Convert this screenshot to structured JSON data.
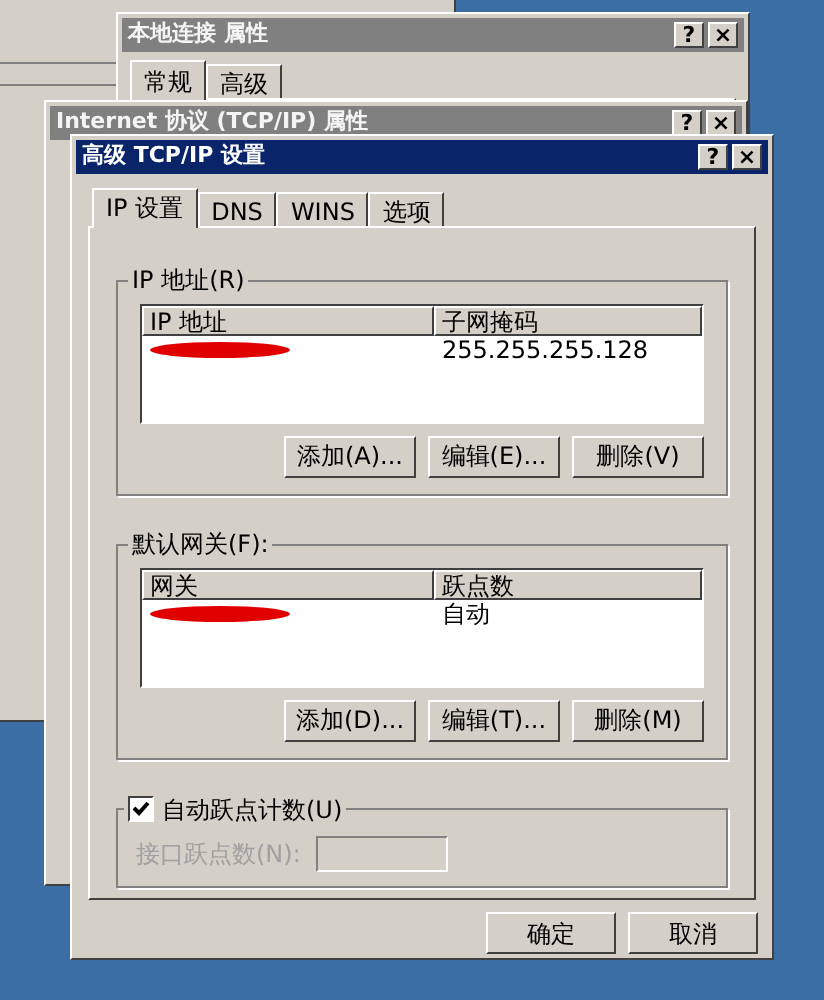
{
  "background_windows": [
    {
      "title": "本地连接 属性",
      "title_buttons": [
        "?",
        "×"
      ],
      "tabs": [
        {
          "label": "常规",
          "selected": true
        },
        {
          "label": "高级",
          "selected": false
        }
      ]
    },
    {
      "title": "Internet 协议 (TCP/IP) 属性",
      "title_buttons": [
        "?",
        "×"
      ]
    }
  ],
  "dialog": {
    "title": "高级 TCP/IP 设置",
    "title_buttons": [
      "?",
      "×"
    ],
    "tabs": [
      {
        "label": "IP 设置",
        "selected": true
      },
      {
        "label": "DNS",
        "selected": false
      },
      {
        "label": "WINS",
        "selected": false
      },
      {
        "label": "选项",
        "selected": false
      }
    ],
    "groups": [
      {
        "legend": "IP 地址(R)",
        "columns": [
          "IP 地址",
          "子网掩码"
        ],
        "rows": [
          {
            "cells": [
              {
                "redacted": true
              },
              {
                "text": "255.255.255.128"
              }
            ]
          }
        ],
        "buttons": [
          "添加(A)...",
          "编辑(E)...",
          "删除(V)"
        ]
      },
      {
        "legend": "默认网关(F):",
        "columns": [
          "网关",
          "跃点数"
        ],
        "rows": [
          {
            "cells": [
              {
                "redacted": true
              },
              {
                "text": "自动"
              }
            ]
          }
        ],
        "buttons": [
          "添加(D)...",
          "编辑(T)...",
          "删除(M)"
        ]
      }
    ],
    "auto_metric": {
      "label": "自动跃点计数(U)",
      "checked": true,
      "field_label": "接口跃点数(N):",
      "field_disabled": true
    },
    "buttons": [
      "确定",
      "取消"
    ]
  }
}
